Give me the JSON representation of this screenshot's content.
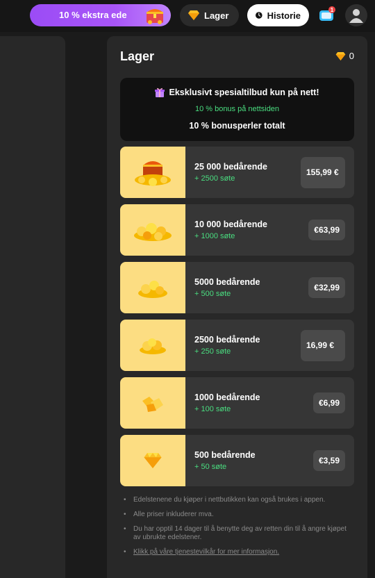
{
  "topbar": {
    "promo_text": "10 % ekstra ede",
    "lager_label": "Lager",
    "historie_label": "Historie",
    "notification_count": "1"
  },
  "store": {
    "title": "Lager",
    "gem_balance": "0",
    "offer": {
      "headline": "Eksklusivt spesialtilbud kun på nett!",
      "subline": "10 % bonus på nettsiden",
      "total": "10 % bonusperler totalt"
    },
    "packs": [
      {
        "name": "25 000 bedårende",
        "bonus": "+ 2500 søte",
        "price": "155,99 €"
      },
      {
        "name": "10 000 bedårende",
        "bonus": "+ 1000 søte",
        "price": "€63,99"
      },
      {
        "name": "5000 bedårende",
        "bonus": "+ 500 søte",
        "price": "€32,99"
      },
      {
        "name": "2500 bedårende",
        "bonus": "+ 250 søte",
        "price": "16,99 €"
      },
      {
        "name": "1000 bedårende",
        "bonus": "+ 100 søte",
        "price": "€6,99"
      },
      {
        "name": "500 bedårende",
        "bonus": "+ 50 søte",
        "price": "€3,59"
      }
    ],
    "notes": [
      "Edelstenene du kjøper i nettbutikken kan også brukes i appen.",
      "Alle priser inkluderer mva.",
      "Du har opptil 14 dager til å benytte deg av retten din til å angre kjøpet av ubrukte edelstener.",
      "Klikk på våre tjenestevilkår for mer informasjon."
    ]
  },
  "colors": {
    "accent_purple": "#a855f7",
    "bonus_green": "#4ade80",
    "gem_yellow": "#fcdd82",
    "gold": "#f5b800"
  },
  "icons": [
    "treasure-chest-icon",
    "gem-icon",
    "clock-icon",
    "chat-notification-icon",
    "user-avatar-icon",
    "gift-icon"
  ]
}
